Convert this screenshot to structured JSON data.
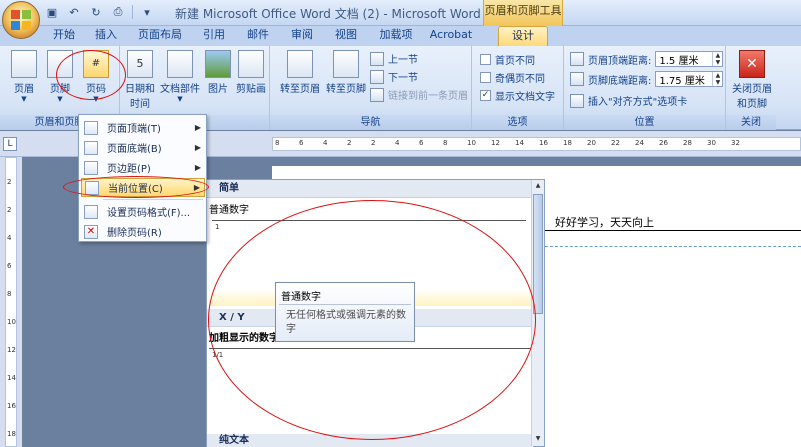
{
  "window": {
    "title": "新建 Microsoft Office Word 文档 (2) - Microsoft Word",
    "context_tab_title": "页眉和页脚工具"
  },
  "tabs": [
    "开始",
    "插入",
    "页面布局",
    "引用",
    "邮件",
    "审阅",
    "视图",
    "加载项",
    "Acrobat",
    "设计"
  ],
  "ribbon": {
    "groups": {
      "header_footer": {
        "label": "页眉和页脚",
        "header": "页眉",
        "footer": "页脚",
        "page_number": "页码"
      },
      "insert": {
        "date_time_1": "日期和",
        "date_time_2": "时间",
        "doc_parts": "文档部件",
        "picture": "图片",
        "clipart": "剪贴画"
      },
      "navigation": {
        "label": "导航",
        "goto_header": "转至页眉",
        "goto_footer": "转至页脚",
        "prev_section": "上一节",
        "next_section": "下一节",
        "link_prev": "链接到前一条页眉"
      },
      "options": {
        "label": "选项",
        "diff_first": "首页不同",
        "diff_odd_even": "奇偶页不同",
        "show_text": "显示文档文字"
      },
      "position": {
        "label": "位置",
        "header_top": "页眉顶端距离:",
        "header_top_value": "1.5 厘米",
        "footer_bottom": "页脚底端距离:",
        "footer_bottom_value": "1.75 厘米",
        "insert_align_tab": "插入\"对齐方式\"选项卡"
      },
      "close": {
        "label": "关闭",
        "close_1": "关闭页眉",
        "close_2": "和页脚"
      }
    }
  },
  "ruler": {
    "corner": "L",
    "ticks": [
      "8",
      "6",
      "4",
      "2",
      "2",
      "4",
      "6",
      "8",
      "10",
      "12",
      "14",
      "16",
      "18",
      "20",
      "22",
      "24",
      "26",
      "28",
      "30",
      "32"
    ],
    "vticks": [
      "2",
      "2",
      "4",
      "6",
      "8",
      "10",
      "12",
      "14",
      "16",
      "18"
    ]
  },
  "document": {
    "header_text": "好好学习，天天向上"
  },
  "menu": {
    "items": [
      {
        "label": "页面顶端(T)"
      },
      {
        "label": "页面底端(B)"
      },
      {
        "label": "页边距(P)"
      },
      {
        "label": "当前位置(C)"
      },
      {
        "label": "设置页码格式(F)..."
      },
      {
        "label": "删除页码(R)"
      }
    ]
  },
  "gallery": {
    "section_simple": "简单",
    "item_plain": "普通数字",
    "item_plain_preview": "1",
    "section_xy": "X / Y",
    "item_bold": "加粗显示的数字",
    "item_bold_preview": "1/1",
    "section_plain_text": "纯文本"
  },
  "tooltip": {
    "title": "普通数字",
    "body": "无任何格式或强调元素的数字"
  },
  "colors": {
    "annotation": "#e01010",
    "active_tab": "#ffd97a",
    "ribbon_bg": "#dbe6f6"
  }
}
